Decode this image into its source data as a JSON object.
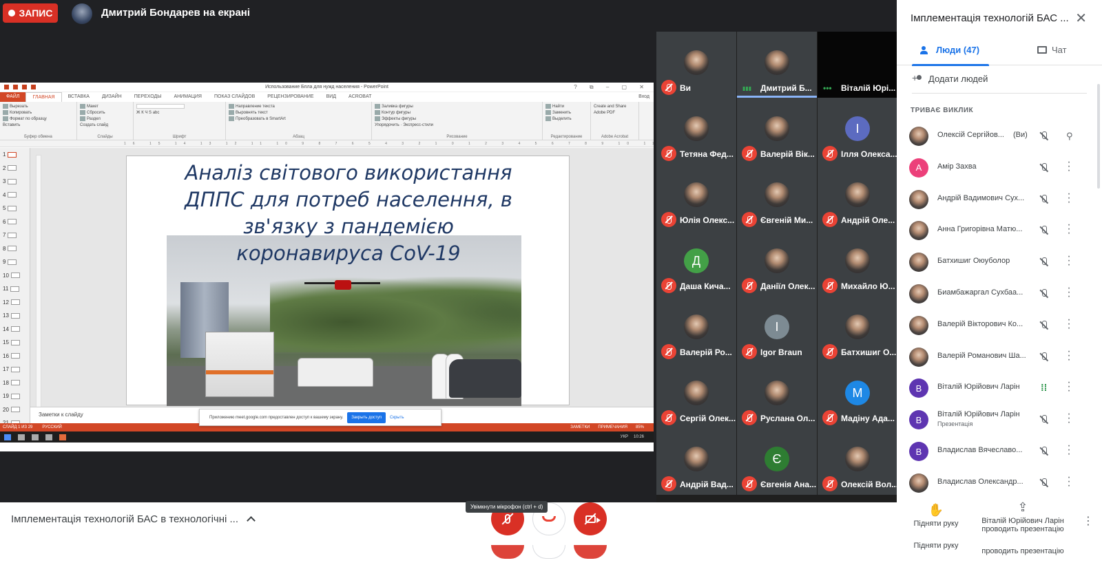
{
  "topbar": {
    "record_label": "ЗАПИС",
    "presenter_text": "Дмитрий Бондарев на екрані"
  },
  "powerpoint": {
    "window_title": "Использование Бпла для нужд населения - PowerPoint",
    "window_controls": "? ⧉ – ▢ ✕",
    "account": "Вход",
    "tabs": [
      {
        "label": "ФАЙЛ"
      },
      {
        "label": "ГЛАВНАЯ"
      },
      {
        "label": "ВСТАВКА"
      },
      {
        "label": "ДИЗАЙН"
      },
      {
        "label": "ПЕРЕХОДЫ"
      },
      {
        "label": "АНИМАЦИЯ"
      },
      {
        "label": "ПОКАЗ СЛАЙДОВ"
      },
      {
        "label": "РЕЦЕНЗИРОВАНИЕ"
      },
      {
        "label": "ВИД"
      },
      {
        "label": "ACROBAT"
      }
    ],
    "ribbon": {
      "paste": "Вставить",
      "cut": "Вырезать",
      "copy": "Копировать",
      "format_painter": "Формат по образцу",
      "clipboard_group": "Буфер обмена",
      "new_slide": "Создать слайд",
      "layout": "Макет",
      "reset": "Сбросить",
      "section": "Раздел",
      "slides_group": "Слайды",
      "font_group": "Шрифт",
      "text_direction": "Направление текста",
      "align_text": "Выровнять текст",
      "smartart": "Преобразовать в SmartArt",
      "paragraph_group": "Абзац",
      "arrange": "Упорядочить",
      "quick_styles": "Экспресс-стили",
      "shape_fill": "Заливка фигуры",
      "shape_outline": "Контур фигуры",
      "shape_effects": "Эффекты фигуры",
      "drawing_group": "Рисование",
      "find": "Найти",
      "replace": "Заменить",
      "select": "Выделить",
      "editing_group": "Редактирование",
      "create_pdf": "Create and Share Adobe PDF",
      "acrobat_group": "Adobe Acrobat"
    },
    "ruler": "16 15 14 13 12 11 10 9 8 7 6 5 4 3 2 1 0 1 2 3 4 5 6 7 8 9 10 11 12 13 14 15 16",
    "thumbs": [
      "1",
      "2",
      "3",
      "4",
      "5",
      "6",
      "7",
      "8",
      "9",
      "10",
      "11",
      "12",
      "13",
      "14",
      "15",
      "16",
      "17",
      "18",
      "19",
      "20",
      "21"
    ],
    "slide_title_lines": [
      "Аналіз світового використання",
      "ДППС для потреб населення, в",
      "зв'язку з пандемією",
      "коронавируса CoV-19"
    ],
    "notes_placeholder": "Заметки к слайду",
    "share_banner_text": "Приложению meet.google.com предоставлен доступ к вашему экрану.",
    "share_banner_stop": "Закрыть доступ",
    "share_banner_hide": "Скрыть",
    "status_slide": "СЛАЙД 1 ИЗ 29",
    "status_lang": "РУССКИЙ",
    "status_notes": "ЗАМЕТКИ",
    "status_comments": "ПРИМЕЧАНИЯ",
    "status_zoom": "85%",
    "tray_lang": "УКР",
    "tray_time": "10:26"
  },
  "grid": {
    "tiles": [
      {
        "name": "Ви",
        "avatar": "photo"
      },
      {
        "name": "Дмитрий Б...",
        "avatar": "photo",
        "speaking": true
      },
      {
        "name": "Віталій Юрі...",
        "black": true
      },
      {
        "name": "Тетяна Фед...",
        "avatar": "photo"
      },
      {
        "name": "Валерій Вік...",
        "avatar": "photo"
      },
      {
        "name": "Ілля Олекса...",
        "initial": "І",
        "color": "#5c6bc0"
      },
      {
        "name": "Юлія Олекс...",
        "avatar": "photo"
      },
      {
        "name": "Євгеній Ми...",
        "avatar": "photo"
      },
      {
        "name": "Андрій Оле...",
        "avatar": "photo"
      },
      {
        "name": "Даша Кича...",
        "initial": "Д",
        "color": "#43a047"
      },
      {
        "name": "Даніїл Олек...",
        "avatar": "photo"
      },
      {
        "name": "Михайло Ю...",
        "avatar": "photo"
      },
      {
        "name": "Валерій Ро...",
        "avatar": "photo"
      },
      {
        "name": "Igor Braun",
        "initial": "I",
        "color": "#7d8b93"
      },
      {
        "name": "Батхишиг О...",
        "avatar": "photo"
      },
      {
        "name": "Сергій Олек...",
        "avatar": "photo"
      },
      {
        "name": "Руслана Ол...",
        "avatar": "photo"
      },
      {
        "name": "Мадіну Ада...",
        "initial": "M",
        "color": "#1e88e5"
      },
      {
        "name": "Андрій Вад...",
        "avatar": "photo"
      },
      {
        "name": "Євгенія Ана...",
        "initial": "Є",
        "color": "#2e7d32"
      },
      {
        "name": "Олексій Вол...",
        "avatar": "photo"
      }
    ]
  },
  "panel": {
    "title": "Імплементація технологій БАС ...",
    "tab_people": "Люди (47)",
    "tab_chat": "Чат",
    "add_people": "Додати людей",
    "section": "ТРИВАЄ ВИКЛИК",
    "participants": [
      {
        "name": "Олексій Сергійов...",
        "suffix": "(Ви)",
        "avatar": "photo",
        "mic": "muted",
        "action": "pin"
      },
      {
        "name": "Амір Захва",
        "initial": "А",
        "color": "#ec407a",
        "mic": "muted"
      },
      {
        "name": "Андрій Вадимович Сух...",
        "avatar": "photo",
        "mic": "muted"
      },
      {
        "name": "Анна Григорівна Матю...",
        "avatar": "photo",
        "mic": "muted"
      },
      {
        "name": "Батхишиг Оюуболор",
        "avatar": "photo",
        "mic": "muted"
      },
      {
        "name": "Биамбажаргал Сухбаа...",
        "avatar": "photo",
        "mic": "muted"
      },
      {
        "name": "Валерій Вікторович Ко...",
        "avatar": "photo",
        "mic": "muted"
      },
      {
        "name": "Валерій Романович Ша...",
        "avatar": "photo",
        "mic": "muted"
      },
      {
        "name": "Віталій Юрійович Ларін",
        "initial": "В",
        "color": "#5e35b1",
        "mic": "speaking"
      },
      {
        "name": "Віталій Юрійович Ларін",
        "sub": "Презентація",
        "initial": "В",
        "color": "#5e35b1",
        "mic": "muted"
      },
      {
        "name": "Владислав Вячеславо...",
        "initial": "В",
        "color": "#5e35b1",
        "mic": "muted"
      },
      {
        "name": "Владислав Олександр...",
        "avatar": "photo",
        "mic": "muted"
      }
    ],
    "raise_hand": "Підняти руку",
    "presenting": "Віталій Юрійович Ларін проводить презентацію",
    "presenting_tail": "проводить презентацію"
  },
  "controls": {
    "meeting_title": "Імплементація технологій БАС в технологічні ...",
    "tooltip": "Увімкнути мікрофон (ctrl + d)"
  },
  "colors": {
    "record": "#d93025",
    "accent": "#1a73e8",
    "danger": "#d93025",
    "ppt": "#d24726"
  }
}
